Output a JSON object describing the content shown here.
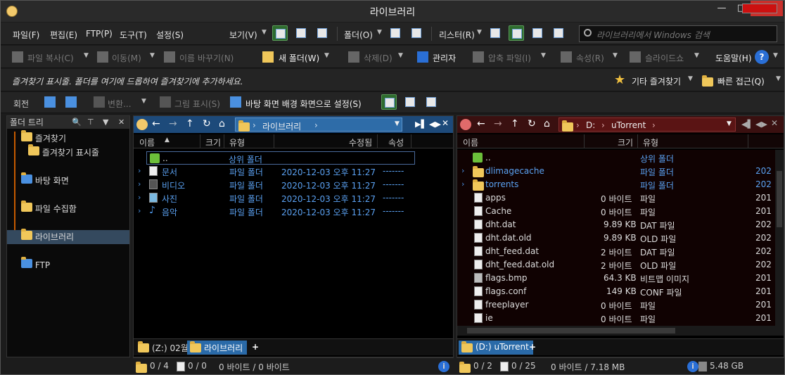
{
  "window": {
    "title": "라이브러리",
    "min": "—",
    "max": "□",
    "close": "✕"
  },
  "menu": [
    "파일(F)",
    "편집(E)",
    "FTP(P)",
    "도구(T)",
    "설정(S)"
  ],
  "menu_view": "보기(V)",
  "menu_folder": "폴더(O)",
  "menu_list": "리스터(R)",
  "search": {
    "placeholder": "라이브러리에서 Windows 검색"
  },
  "toolbar2": {
    "copy": "파일 복사(C)",
    "move": "이동(M)",
    "rename": "이름 바꾸기(N)",
    "newfolder": "새 폴더(W)",
    "delete": "삭제(D)",
    "admin": "관리자",
    "zip": "압축 파일(I)",
    "props": "속성(R)",
    "slideshow": "슬라이드쇼",
    "help": "도움말(H)"
  },
  "toolbar3": {
    "favbar": "즐겨찾기 표시줄. 폴더를 여기에 드롭하여 즐겨찾기에 추가하세요.",
    "other_fav": "기타 즐겨찾기",
    "quick": "빠른 접근(Q)"
  },
  "toolbar4": {
    "rotate": "회전",
    "convert": "변환...",
    "show_img": "그림 표시(S)",
    "set_wall": "바탕 화면 배경 화면으로 설정(S)"
  },
  "tree": {
    "title": "폴더 트리",
    "items": [
      "즐겨찾기",
      "즐겨찾기 표시줄",
      "바탕 화면",
      "파일 수집함",
      "라이브러리",
      "FTP"
    ]
  },
  "left": {
    "path": "라이브러리",
    "cols": [
      "이름",
      "크기",
      "유형",
      "수정됨",
      "속성"
    ],
    "rows": [
      {
        "name": "..",
        "type": "상위 폴더",
        "date": "",
        "attr": ""
      },
      {
        "name": "문서",
        "type": "파일 폴더",
        "date": "2020-12-03  오후 11:27",
        "attr": "-------"
      },
      {
        "name": "비디오",
        "type": "파일 폴더",
        "date": "2020-12-03  오후 11:27",
        "attr": "-------"
      },
      {
        "name": "사진",
        "type": "파일 폴더",
        "date": "2020-12-03  오후 11:27",
        "attr": "-------"
      },
      {
        "name": "음악",
        "type": "파일 폴더",
        "date": "2020-12-03  오후 11:27",
        "attr": "-------"
      }
    ],
    "tabs": [
      "(Z:) 02월",
      "라이브러리",
      "+"
    ],
    "status": {
      "folders": "0 / 4",
      "files": "0 / 0",
      "bytes": "0 바이트 / 0 바이트"
    }
  },
  "right": {
    "path_drive": "D:",
    "path_dir": "uTorrent",
    "cols": [
      "이름",
      "크기",
      "유형"
    ],
    "rows": [
      {
        "name": "..",
        "size": "",
        "type": "상위 폴더",
        "date": ""
      },
      {
        "name": "dlimagecache",
        "size": "",
        "type": "파일 폴더",
        "date": "202"
      },
      {
        "name": "torrents",
        "size": "",
        "type": "파일 폴더",
        "date": "202"
      },
      {
        "name": "apps",
        "size": "0 바이트",
        "type": "파일",
        "date": "201"
      },
      {
        "name": "Cache",
        "size": "0 바이트",
        "type": "파일",
        "date": "201"
      },
      {
        "name": "dht.dat",
        "size": "9.89 KB",
        "type": "DAT 파일",
        "date": "202"
      },
      {
        "name": "dht.dat.old",
        "size": "9.89 KB",
        "type": "OLD 파일",
        "date": "202"
      },
      {
        "name": "dht_feed.dat",
        "size": "2 바이트",
        "type": "DAT 파일",
        "date": "202"
      },
      {
        "name": "dht_feed.dat.old",
        "size": "2 바이트",
        "type": "OLD 파일",
        "date": "202"
      },
      {
        "name": "flags.bmp",
        "size": "64.3 KB",
        "type": "비트맵 이미지",
        "date": "201"
      },
      {
        "name": "flags.conf",
        "size": "149 KB",
        "type": "CONF 파일",
        "date": "201"
      },
      {
        "name": "freeplayer",
        "size": "0 바이트",
        "type": "파일",
        "date": "201"
      },
      {
        "name": "ie",
        "size": "0 바이트",
        "type": "파일",
        "date": "201"
      }
    ],
    "tabs": [
      "(D:) uTorrent",
      "+"
    ],
    "status": {
      "folders": "0 / 2",
      "files": "0 / 25",
      "bytes": "0 바이트 / 7.18 MB",
      "free": "5.48 GB"
    }
  },
  "colors": {
    "accent_blue": "#2a6aa8",
    "right_addr": "#3a1010",
    "highlight_green": "#2d6b2d",
    "link_blue": "#5aa0f0"
  }
}
